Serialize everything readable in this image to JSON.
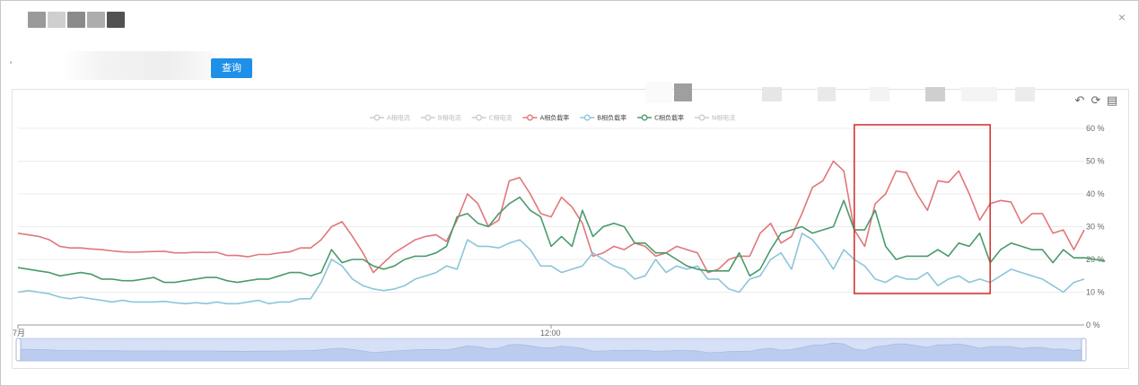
{
  "dialog": {
    "close_icon": "×",
    "query_button": "查询",
    "apostrophe": "'"
  },
  "toolbox": {
    "restore_icon": "↶",
    "refresh_icon": "⟳",
    "save_icon": "▤"
  },
  "colors": {
    "a": "#e0777a",
    "b": "#8cc5da",
    "c": "#4a9a6c",
    "legend_inactive": "#cccccc",
    "highlight_box": "#d42a2a",
    "query_button": "#1e90e8"
  },
  "chart_data": {
    "type": "line",
    "legend": [
      "A相电流",
      "B相电流",
      "C相电流",
      "A相负载率",
      "B相负载率",
      "C相负载率",
      "N相电流"
    ],
    "legend_active": [
      false,
      false,
      false,
      true,
      true,
      true,
      false
    ],
    "legend_placement": "top-center",
    "grid": true,
    "y_axis": {
      "position": "right",
      "min": 0,
      "max": 60,
      "ticks": [
        "0 %",
        "10 %",
        "20 %",
        "30 %",
        "40 %",
        "50 %",
        "60 %"
      ]
    },
    "x_axis": {
      "tick_labels": [
        "7月",
        "12:00"
      ]
    },
    "series": [
      {
        "name": "A相负载率",
        "values": [
          28,
          27.5,
          27,
          26,
          24,
          23.5,
          23.5,
          23.2,
          23,
          22.6,
          22.3,
          22.2,
          22.3,
          22.4,
          22.5,
          22,
          22,
          22.2,
          22.1,
          22.2,
          21.2,
          21.2,
          20.8,
          21.5,
          21.5,
          22,
          22.3,
          23.5,
          23.5,
          26,
          30,
          31.5,
          27,
          22,
          16,
          19,
          22,
          24,
          26,
          27,
          27.5,
          25.5,
          32,
          40,
          37,
          30,
          32,
          44,
          45,
          40,
          34,
          33,
          39,
          36,
          31,
          21,
          22,
          24,
          23,
          25,
          24,
          21,
          22,
          24,
          23,
          22,
          16,
          17,
          20,
          21,
          21,
          28,
          31,
          25,
          27,
          34,
          42,
          44,
          50,
          47,
          29,
          24,
          37,
          40,
          47,
          46.5,
          40,
          35,
          44,
          43.5,
          47,
          40,
          32,
          37,
          38,
          37.5,
          31,
          34,
          34,
          28,
          29,
          23,
          29
        ]
      },
      {
        "name": "B相负载率",
        "values": [
          10,
          10.5,
          10,
          9.5,
          8.5,
          8,
          8.5,
          8,
          7.5,
          7,
          7.5,
          7,
          7,
          7,
          7.2,
          6.8,
          6.5,
          6.8,
          6.5,
          7,
          6.5,
          6.5,
          7,
          7.5,
          6.5,
          7,
          7,
          8,
          8,
          13,
          20,
          18,
          14,
          12,
          11,
          10.5,
          11,
          12,
          14,
          15,
          16,
          18,
          17,
          26,
          24,
          24,
          23.5,
          25,
          26,
          23,
          18,
          18,
          16,
          17,
          18,
          22,
          20,
          18,
          17,
          14,
          15,
          20,
          16,
          18,
          17,
          18,
          14,
          14,
          11,
          10,
          14,
          15,
          20,
          22,
          17,
          28,
          26,
          22,
          17,
          23,
          20,
          18,
          14,
          13,
          15,
          14,
          14,
          16,
          12,
          14,
          15,
          13,
          14,
          13,
          15,
          17,
          16,
          15,
          14,
          12,
          10,
          13,
          14
        ]
      },
      {
        "name": "C相负载率",
        "values": [
          17.5,
          17,
          16.5,
          16,
          15,
          15.5,
          16,
          15.5,
          14,
          14,
          13.5,
          13.5,
          14,
          14.5,
          13,
          13,
          13.5,
          14,
          14.5,
          14.5,
          13.5,
          13,
          13.5,
          14,
          14,
          15,
          16,
          16,
          15,
          16,
          23,
          19,
          20,
          20,
          18,
          17,
          18,
          20,
          21,
          21,
          22,
          24,
          33,
          34,
          31,
          30,
          34,
          37,
          39,
          35,
          33,
          24,
          27,
          24,
          35,
          27,
          30,
          31,
          30,
          25,
          25,
          22,
          22,
          20,
          18,
          17,
          16.5,
          16.5,
          16.5,
          22,
          15,
          17,
          23,
          28,
          29,
          30,
          28,
          29,
          30,
          38,
          29,
          29,
          35,
          24,
          20,
          21,
          21,
          21,
          23,
          21,
          25,
          24,
          28,
          19,
          23,
          25,
          24,
          23,
          23,
          19,
          23,
          20.5,
          20.5,
          20,
          19.5
        ]
      }
    ],
    "highlight_region": {
      "x_start_index": 80,
      "x_end_index": 93
    }
  }
}
